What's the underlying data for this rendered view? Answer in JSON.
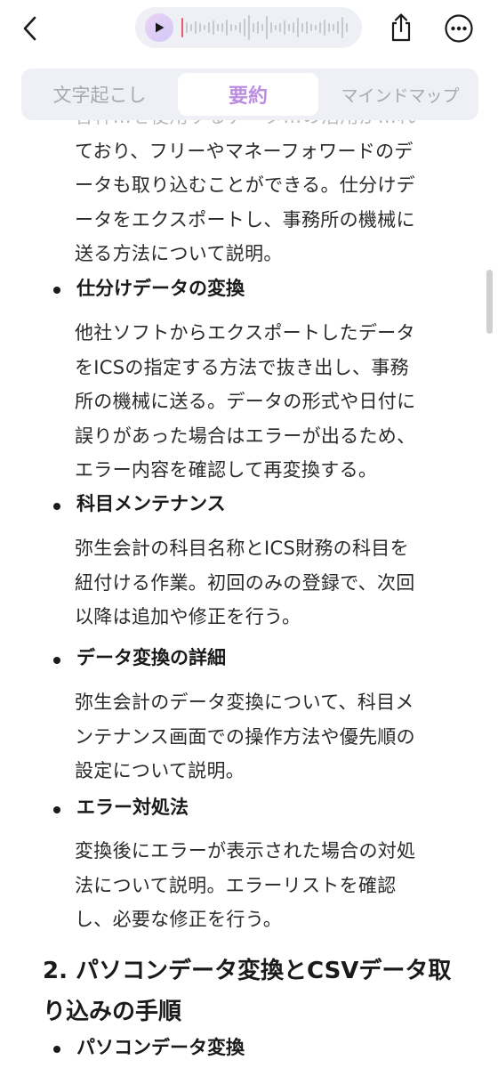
{
  "header": {
    "back_icon": "chevron-left-icon",
    "play_icon": "play-icon",
    "share_icon": "share-icon",
    "more_icon": "more-horizontal-icon",
    "colors": {
      "accent": "#bc8ee0",
      "waveform_marker": "#e85a6a",
      "waveform_bars": "#c7c9cf"
    }
  },
  "tabs": [
    {
      "label": "文字起こし",
      "selected": false
    },
    {
      "label": "要約",
      "selected": true
    },
    {
      "label": "マインドマップ",
      "selected": false
    }
  ],
  "content": {
    "intro_lines": [
      "各种…を使用するデータ…の活用が…れ",
      "ており、フリーやマネーフォワードのデ",
      "ータも取り込むことができる。仕分けデ",
      "ータをエクスポートし、事務所の機械に",
      "送る方法について説明。"
    ],
    "items": [
      {
        "heading": "仕分けデータの変換",
        "lines": [
          "他社ソフトからエクスポートしたデータ",
          "をICSの指定する方法で抜き出し、事務",
          "所の機械に送る。データの形式や日付に",
          "誤りがあった場合はエラーが出るため、",
          "エラー内容を確認して再変換する。"
        ]
      },
      {
        "heading": "科目メンテナンス",
        "lines": [
          "弥生会計の科目名称とICS財務の科目を",
          "紐付ける作業。初回のみの登録で、次回",
          "以降は追加や修正を行う。"
        ]
      },
      {
        "heading": "データ変換の詳細",
        "lines": [
          "弥生会計のデータ変換について、科目メ",
          "ンテナンス画面での操作方法や優先順の",
          "設定について説明。"
        ]
      },
      {
        "heading": "エラー対処法",
        "lines": [
          "変換後にエラーが表示された場合の対処",
          "法について説明。エラーリストを確認",
          "し、必要な修正を行う。"
        ]
      }
    ],
    "section_title": "2. パソコンデータ変換とCSVデータ取り込みの手順",
    "section_items": [
      {
        "heading": "パソコンデータ変換"
      }
    ]
  }
}
